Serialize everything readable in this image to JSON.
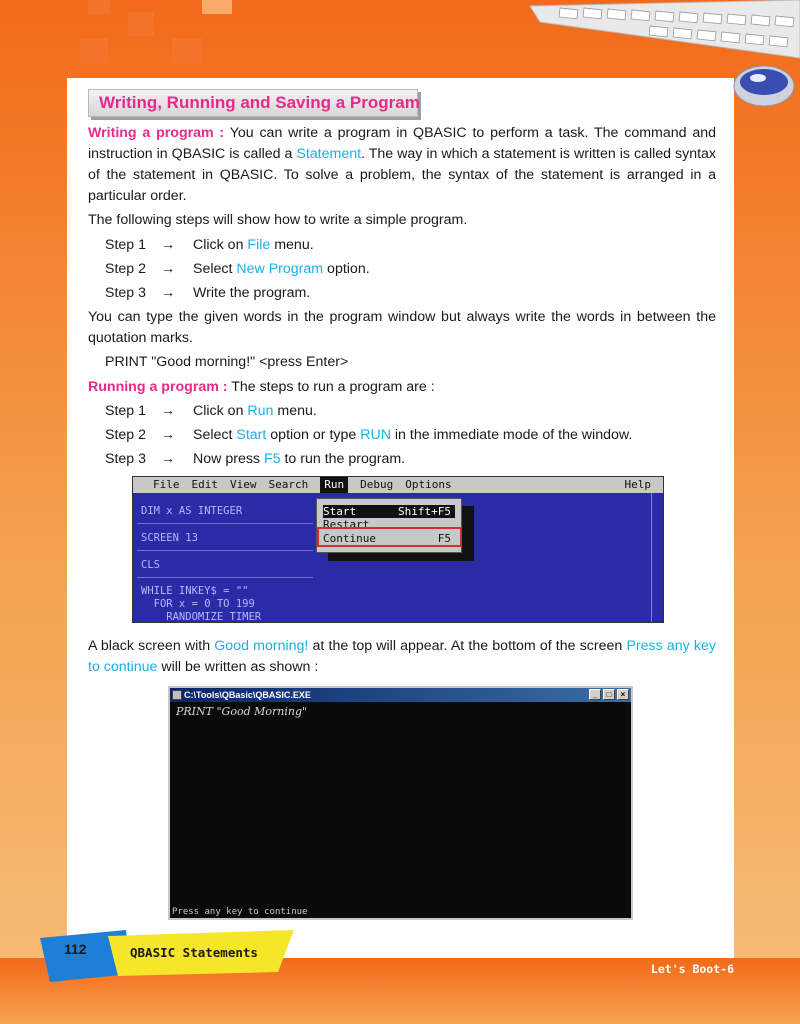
{
  "heading": "Writing, Running and Saving a Program",
  "writing": {
    "term": "Writing a program :",
    "text_1": " You can write a program in QBASIC to perform a task. The command and instruction in QBASIC is called a ",
    "statement": "Statement",
    "text_2": ". The way in which a statement is written is called syntax of the statement in QBASIC. To solve a problem, the syntax of the statement is arranged in a particular order."
  },
  "steps_intro": "The following steps will show how to write a simple program.",
  "write_steps": [
    {
      "label": "Step 1",
      "arrow": "→",
      "before": "Click on ",
      "highlight": "File",
      "after": " menu."
    },
    {
      "label": "Step 2",
      "arrow": "→",
      "before": "Select ",
      "highlight": "New Program",
      "after": " option."
    },
    {
      "label": "Step 3",
      "arrow": "→",
      "before": "Write the program.",
      "highlight": "",
      "after": ""
    }
  ],
  "quotation_note": "You can type the given words in the program window but always write the words in between the quotation marks.",
  "example_code": "PRINT \"Good morning!\" <press Enter>",
  "running": {
    "term": "Running a program :",
    "text": " The steps to run a program are :"
  },
  "run_steps": [
    {
      "label": "Step 1",
      "arrow": "→",
      "before": "Click on ",
      "highlight": "Run",
      "after": " menu.",
      "highlight2": "",
      "after2": ""
    },
    {
      "label": "Step 2",
      "arrow": "→",
      "before": "Select ",
      "highlight": "Start",
      "after": " option or type ",
      "highlight2": "RUN",
      "after2": " in the immediate mode of the window."
    },
    {
      "label": "Step 3",
      "arrow": "→",
      "before": "Now press ",
      "highlight": "F5",
      "after": " to run the program.",
      "highlight2": "",
      "after2": ""
    }
  ],
  "ide": {
    "menu": [
      "File",
      "Edit",
      "View",
      "Search",
      "Run",
      "Debug",
      "Options"
    ],
    "help": "Help",
    "dropdown": [
      {
        "label": "Start",
        "key": "Shift+F5"
      },
      {
        "label": "Restart",
        "key": ""
      },
      {
        "label": "Continue",
        "key": "F5"
      }
    ],
    "code": [
      "DIM x AS INTEGER",
      "SCREEN 13",
      "CLS",
      "WHILE INKEY$ = \"\"",
      "  FOR x = 0 TO 199",
      "    RANDOMIZE TIMER"
    ]
  },
  "black_screen": {
    "text_1": "A black screen with ",
    "good_morning": "Good morning!",
    "text_2": " at the top will appear. At the bottom of the screen ",
    "press_any_key": "Press any key to continue",
    "text_3": " will be written as shown :"
  },
  "console": {
    "title": "C:\\Tools\\QBasic\\QBASIC.EXE",
    "output": "PRINT \"Good Morning\"",
    "footer": "Press any key to continue",
    "buttons": [
      "_",
      "□",
      "×"
    ]
  },
  "footer": {
    "page_number": "112",
    "chapter": "QBASIC Statements",
    "book": "Let's Boot-6"
  },
  "colors": {
    "pink": "#e8298c",
    "cyan": "#1ab0e6",
    "green": "#2fae4a",
    "orange": "#f26a1b"
  }
}
